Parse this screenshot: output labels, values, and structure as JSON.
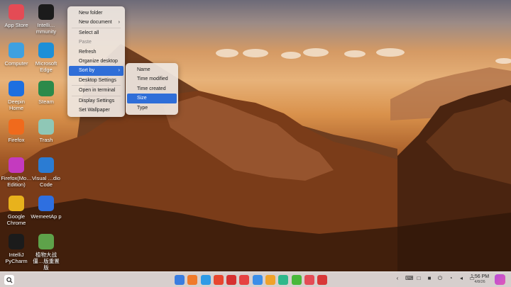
{
  "desktop_icons": [
    {
      "label": "App Store",
      "icon": "app-store-icon",
      "color": "#e44b55"
    },
    {
      "label": "Intelli…mmunity",
      "icon": "intellij-community-icon",
      "color": "#1b1b1b"
    },
    {
      "label": "Computer",
      "icon": "computer-icon",
      "color": "#3fa0e0"
    },
    {
      "label": "Microsoft Edge",
      "icon": "edge-icon",
      "color": "#1c8fd8"
    },
    {
      "label": "Deepin Home",
      "icon": "deepin-home-icon",
      "color": "#1d6fe0"
    },
    {
      "label": "Steam",
      "icon": "steam-icon",
      "color": "#2b8a4a"
    },
    {
      "label": "Firefox",
      "icon": "firefox-icon",
      "color": "#f06a1c"
    },
    {
      "label": "Trash",
      "icon": "trash-icon",
      "color": "#8fc7b6"
    },
    {
      "label": "Firefox(Mo…Edition)",
      "icon": "firefox-mobile-icon",
      "color": "#c43abf"
    },
    {
      "label": "Visual …dio Code",
      "icon": "vscode-icon",
      "color": "#2b7cd3"
    },
    {
      "label": "Google Chrome",
      "icon": "chrome-icon",
      "color": "#e8b21c"
    },
    {
      "label": "WemeetAp p",
      "icon": "wemeet-icon",
      "color": "#2e6fe0"
    },
    {
      "label": "IntelliJ PyCharm",
      "icon": "pycharm-icon",
      "color": "#1b1b1b"
    },
    {
      "label": "植物大战僵…版重置版",
      "icon": "plants-vs-zombies-icon",
      "color": "#5ea24a"
    }
  ],
  "context_menu": {
    "items": [
      {
        "label": "New folder",
        "disabled": false,
        "submenu": false
      },
      {
        "label": "New document",
        "disabled": false,
        "submenu": true
      },
      {
        "label": "Select all",
        "disabled": false,
        "submenu": false,
        "sep_before": true
      },
      {
        "label": "Paste",
        "disabled": true,
        "submenu": false
      },
      {
        "label": "Refresh",
        "disabled": false,
        "submenu": false
      },
      {
        "label": "Organize desktop",
        "disabled": false,
        "submenu": false
      },
      {
        "label": "Sort by",
        "disabled": false,
        "submenu": true,
        "active": true
      },
      {
        "label": "Desktop Settings",
        "disabled": false,
        "submenu": false
      },
      {
        "label": "Open in terminal",
        "disabled": false,
        "submenu": false,
        "sep_before": true
      },
      {
        "label": "Display Settings",
        "disabled": false,
        "submenu": false,
        "sep_before": true
      },
      {
        "label": "Set Wallpaper",
        "disabled": false,
        "submenu": false
      }
    ]
  },
  "sort_submenu": {
    "items": [
      {
        "label": "Name",
        "active": false
      },
      {
        "label": "Time modified",
        "active": false
      },
      {
        "label": "Time created",
        "active": false
      },
      {
        "label": "Size",
        "active": true
      },
      {
        "label": "Type",
        "active": false
      }
    ]
  },
  "taskbar": {
    "dock_apps": [
      {
        "icon": "launcher-icon",
        "color": "#3a7de0"
      },
      {
        "icon": "multitask-view-icon",
        "color": "#f07a2a"
      },
      {
        "icon": "file-manager-icon",
        "color": "#2f9be6"
      },
      {
        "icon": "text-editor-icon",
        "color": "#e8462e"
      },
      {
        "icon": "terminal-icon",
        "color": "#d63030"
      },
      {
        "icon": "calendar-icon",
        "color": "#e64242"
      },
      {
        "icon": "music-icon",
        "color": "#3b8ee8"
      },
      {
        "icon": "notes-icon",
        "color": "#f0a22a"
      },
      {
        "icon": "draw-icon",
        "color": "#2eb88a"
      },
      {
        "icon": "control-center-icon",
        "color": "#49b83a"
      },
      {
        "icon": "app-store-icon",
        "color": "#e44b55"
      },
      {
        "icon": "screenshot-icon",
        "color": "#d83838"
      }
    ],
    "tray_icons": [
      "arrow-icon",
      "keyboard-icon",
      "clipboard-icon",
      "notification-icon",
      "power-icon",
      "wifi-icon",
      "volume-icon",
      "battery-icon"
    ],
    "clock_time": "1:56 PM",
    "clock_date": "4/8/26"
  }
}
